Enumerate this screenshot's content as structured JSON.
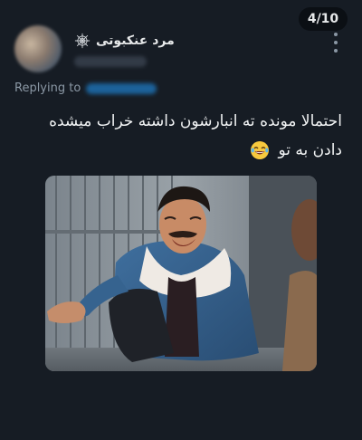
{
  "header": {
    "page_counter": "4/10",
    "display_name": "مرد عنکبوتی",
    "name_icon": "spider-web-icon",
    "more_icon": "more-vertical-icon"
  },
  "reply": {
    "label": "Replying to"
  },
  "tweet": {
    "line1": "احتمالا مونده ته انبارشون داشته خراب میشده",
    "line2": "دادن به تو",
    "emoji_icon": "laughing-tears-emoji-icon"
  },
  "colors": {
    "background": "#161c24",
    "text": "#e7e9ea",
    "muted": "#8b98a5",
    "accent": "#1d9bf0"
  }
}
